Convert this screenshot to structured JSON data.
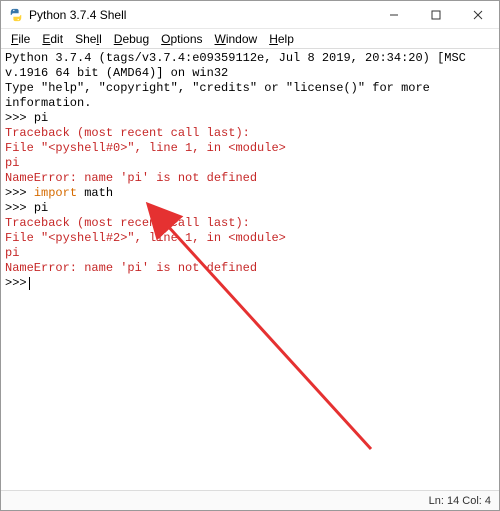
{
  "titlebar": {
    "title": "Python 3.7.4 Shell"
  },
  "menubar": {
    "items": [
      {
        "ul": "F",
        "rest": "ile"
      },
      {
        "ul": "E",
        "rest": "dit"
      },
      {
        "ul": "",
        "rest": "She",
        "ul2": "l",
        "rest2": "l"
      },
      {
        "ul": "D",
        "rest": "ebug"
      },
      {
        "ul": "O",
        "rest": "ptions"
      },
      {
        "ul": "W",
        "rest": "indow"
      },
      {
        "ul": "H",
        "rest": "elp"
      }
    ]
  },
  "shell": {
    "banner1": "Python 3.7.4 (tags/v3.7.4:e09359112e, Jul  8 2019, 20:34:20) [MSC v.1916 64 bit (AMD64)] on win32",
    "banner2": "Type \"help\", \"copyright\", \"credits\" or \"license()\" for more information.",
    "prompt": ">>>",
    "input1": "pi",
    "err1a": "Traceback (most recent call last):",
    "err1b": "  File \"<pyshell#0>\", line 1, in <module>",
    "err1c": "    pi",
    "err1d": "NameError: name 'pi' is not defined",
    "input2_kw": "import",
    "input2_rest": " math",
    "input3": "pi",
    "err2a": "Traceback (most recent call last):",
    "err2b": "  File \"<pyshell#2>\", line 1, in <module>",
    "err2c": "    pi",
    "err2d": "NameError: name 'pi' is not defined"
  },
  "status": {
    "text": "Ln: 14  Col: 4"
  }
}
